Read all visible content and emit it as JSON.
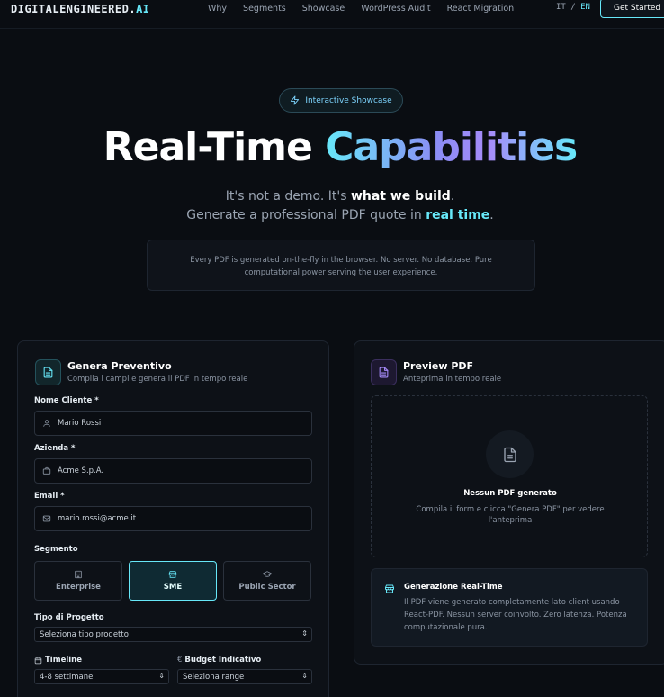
{
  "nav": {
    "logo_main": "DIGITALENGINEERED",
    "logo_dot": ".",
    "logo_ai": "AI",
    "links": [
      "Why",
      "Segments",
      "Showcase",
      "WordPress Audit",
      "React Migration"
    ],
    "lang_it": "IT",
    "lang_sep": "/",
    "lang_en": "EN",
    "cta": "Get Started"
  },
  "hero": {
    "pill": "Interactive Showcase",
    "title_plain": "Real-Time",
    "title_grad": "Capabilities",
    "sub1_a": "It's not a demo. It's ",
    "sub1_b": "what we build",
    "sub1_c": ".",
    "sub2_a": "Generate a professional PDF quote in ",
    "sub2_b": "real time",
    "sub2_c": ".",
    "note": "Every PDF is generated on-the-fly in the browser. No server. No database. Pure computational power serving the user experience."
  },
  "form": {
    "title": "Genera Preventivo",
    "subtitle": "Compila i campi e genera il PDF in tempo reale",
    "name_label": "Nome Cliente *",
    "name_value": "Mario Rossi",
    "company_label": "Azienda *",
    "company_value": "Acme S.p.A.",
    "email_label": "Email *",
    "email_value": "mario.rossi@acme.it",
    "segment_label": "Segmento",
    "segments": [
      {
        "label": "Enterprise",
        "icon": "building-icon",
        "active": false
      },
      {
        "label": "SME",
        "icon": "store-icon",
        "active": true
      },
      {
        "label": "Public Sector",
        "icon": "graduation-cap-icon",
        "active": false
      }
    ],
    "project_type_label": "Tipo di Progetto",
    "project_type_value": "Seleziona tipo progetto",
    "timeline_label": "Timeline",
    "timeline_value": "4-8 settimane",
    "budget_label": "Budget Indicativo",
    "budget_symbol": "€",
    "budget_value": "Seleziona range"
  },
  "preview": {
    "title": "Preview PDF",
    "subtitle": "Anteprima in tempo reale",
    "empty_title": "Nessun PDF generato",
    "empty_text": "Compila il form e clicca \"Genera PDF\" per vedere l'anteprima",
    "info_title": "Generazione Real-Time",
    "info_text": "Il PDF viene generato completamente lato client usando React-PDF. Nessun server coinvolto. Zero latenza. Potenza computazionale pura."
  },
  "colors": {
    "accent": "#67e8f9",
    "purple": "#a78bfa",
    "background": "#0a0d12",
    "panel": "#0d1117"
  }
}
